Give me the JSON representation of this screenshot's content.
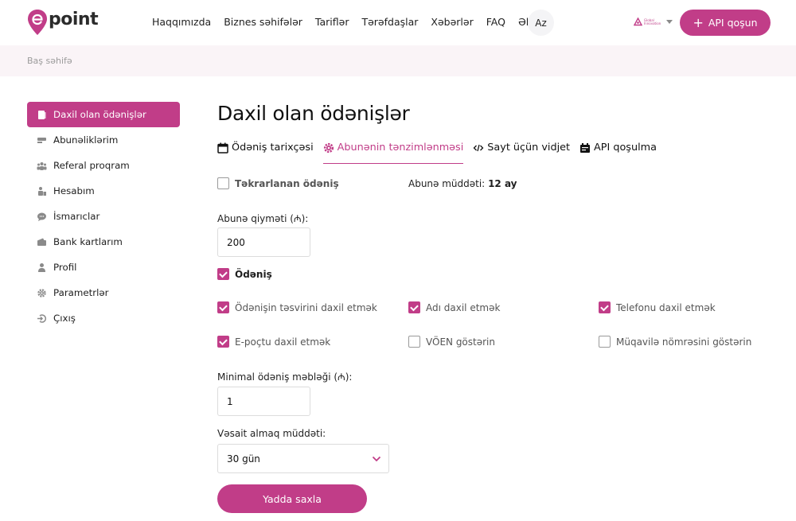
{
  "header": {
    "logo_text": "point",
    "nav": [
      "Haqqımızda",
      "Biznes səhifələr",
      "Tariflər",
      "Tərəfdaşlar",
      "Xəbərlər",
      "FAQ",
      "Əlaqə"
    ],
    "lang": "Az",
    "partner_text": "Global Innovation",
    "api_button": "API qoşun",
    "accent": "#c13d88"
  },
  "breadcrumb": "Baş səhifə",
  "sidebar": {
    "items": [
      {
        "label": "Daxil olan ödənişlər",
        "icon": "document-icon"
      },
      {
        "label": "Abunəliklərim",
        "icon": "subscription-icon"
      },
      {
        "label": "Referal proqram",
        "icon": "group-icon"
      },
      {
        "label": "Hesabım",
        "icon": "account-icon"
      },
      {
        "label": "İsmarıclar",
        "icon": "chat-icon"
      },
      {
        "label": "Bank kartlarım",
        "icon": "wallet-icon"
      },
      {
        "label": "Profil",
        "icon": "user-icon"
      },
      {
        "label": "Parametrlər",
        "icon": "gear-icon"
      },
      {
        "label": "Çıxış",
        "icon": "logout-icon"
      }
    ]
  },
  "main": {
    "title": "Daxil olan ödənişlər",
    "tabs": [
      {
        "label": "Ödəniş tarixçəsi",
        "icon": "calendar-icon"
      },
      {
        "label": "Abunənin tənzimlənməsi",
        "icon": "gear-icon"
      },
      {
        "label": "Sayt üçün vidjet",
        "icon": "code-icon"
      },
      {
        "label": "API qoşulma",
        "icon": "api-icon"
      }
    ],
    "recurring_label": "Təkrarlanan ödəniş",
    "duration_label": "Abunə müddəti:",
    "duration_value": "12 ay",
    "price_label": "Abunə qiyməti (₼):",
    "price_value": "200",
    "payment_label": "Ödəniş",
    "options": [
      {
        "label": "Ödənişin təsvirini daxil etmək",
        "checked": true
      },
      {
        "label": "Adı daxil etmək",
        "checked": true
      },
      {
        "label": "Telefonu daxil etmək",
        "checked": true
      },
      {
        "label": "E-poçtu daxil etmək",
        "checked": true
      },
      {
        "label": "VÖEN göstərin",
        "checked": false
      },
      {
        "label": "Müqavilə nömrəsini göstərin",
        "checked": false
      }
    ],
    "min_label": "Minimal ödəniş məbləği (₼):",
    "min_value": "1",
    "withdraw_label": "Vəsait almaq müddəti:",
    "withdraw_value": "30 gün",
    "save_button": "Yadda saxla"
  }
}
